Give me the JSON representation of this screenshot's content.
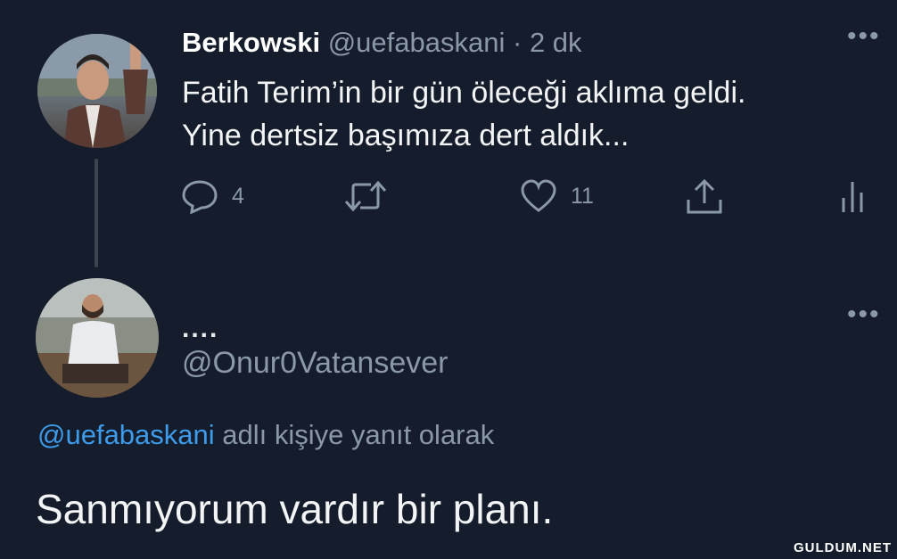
{
  "tweet": {
    "display_name": "Berkowski",
    "handle": "@uefabaskani",
    "separator": "·",
    "time": "2 dk",
    "more": "•••",
    "text_line1": "Fatih Terim’in bir gün öleceği aklıma geldi.",
    "text_line2": "Yine dertsiz başımıza dert aldık...",
    "actions": {
      "reply_icon": "reply-icon",
      "reply_count": "4",
      "retweet_icon": "retweet-icon",
      "like_icon": "heart-icon",
      "like_count": "11",
      "share_icon": "share-icon",
      "analytics_icon": "analytics-icon"
    }
  },
  "reply": {
    "display_name": "....",
    "handle": "@Onur0Vatansever",
    "more": "•••",
    "replying_to_mention": "@uefabaskani",
    "replying_to_suffix": " adlı kişiye yanıt olarak",
    "text": "Sanmıyorum vardır bir planı."
  },
  "watermark": "GULDUM.NET",
  "colors": {
    "background": "#151c2b",
    "text_primary": "#e7e9ea",
    "text_secondary": "#8b98a5",
    "mention": "#3d9be9"
  }
}
